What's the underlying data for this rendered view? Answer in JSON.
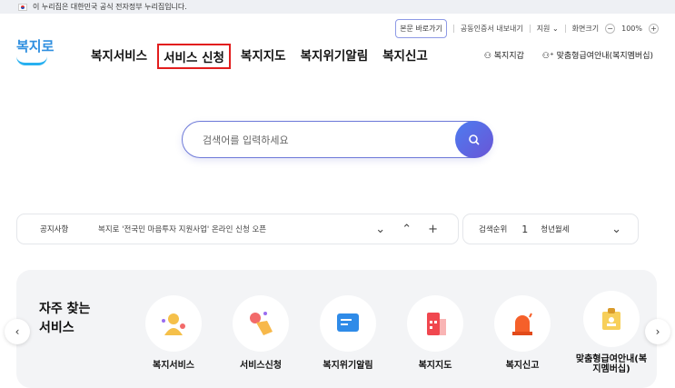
{
  "gov_banner": {
    "text": "이 누리집은 대한민국 공식 전자정부 누리집입니다."
  },
  "utility": {
    "skip": "본문 바로가기",
    "cert": "공동인증서 내보내기",
    "support": "지원",
    "zoom_label": "화면크기",
    "zoom_minus": "−",
    "zoom_value": "100%",
    "zoom_plus": "+"
  },
  "logo": {
    "text": "복지로"
  },
  "nav": [
    {
      "label": "복지서비스"
    },
    {
      "label": "서비스 신청"
    },
    {
      "label": "복지지도"
    },
    {
      "label": "복지위기알림"
    },
    {
      "label": "복지신고"
    }
  ],
  "right_nav": {
    "wallet": "복지지갑",
    "membership": "맞춤형급여안내(복지멤버십)"
  },
  "search": {
    "placeholder": "검색어를 입력하세요"
  },
  "notice": {
    "label": "공지사항",
    "text": "복지로 '전국민 마음투자 지원사업' 온라인 신청 오픈"
  },
  "rank": {
    "label": "검색순위",
    "number": "1",
    "term": "청년월세"
  },
  "favorites": {
    "title_line1": "자주 찾는",
    "title_line2": "서비스",
    "items": [
      {
        "label": "복지서비스",
        "color": "#f5c04a"
      },
      {
        "label": "서비스신청",
        "color": "#f7b84a"
      },
      {
        "label": "복지위기알림",
        "color": "#2f8be8"
      },
      {
        "label": "복지지도",
        "color": "#f0474f"
      },
      {
        "label": "복지신고",
        "color": "#f5602a"
      },
      {
        "label": "맞춤형급여안내(복지멤버십)",
        "color": "#f7cf5a"
      }
    ]
  }
}
